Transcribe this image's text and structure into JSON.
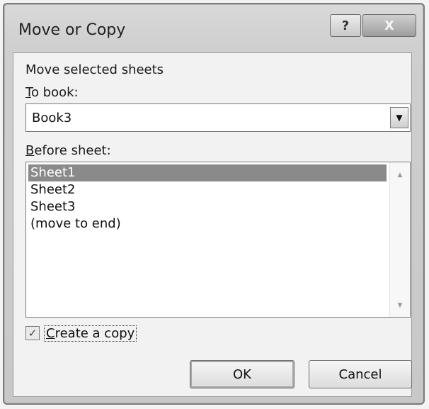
{
  "window": {
    "title": "Move or Copy",
    "help_glyph": "?",
    "close_glyph": "X"
  },
  "move_selected_label": "Move selected sheets",
  "to_book": {
    "label_mnemonic": "T",
    "label_rest": "o book:",
    "selected_value": "Book3",
    "dropdown_icon": "chevron-down-icon"
  },
  "before_sheet": {
    "label_mnemonic": "B",
    "label_rest": "efore sheet:",
    "items": [
      "Sheet1",
      "Sheet2",
      "Sheet3",
      "(move to end)"
    ],
    "selected_index": 0
  },
  "create_copy": {
    "checked": true,
    "label_mnemonic": "C",
    "label_rest": "reate a copy"
  },
  "buttons": {
    "ok_label": "OK",
    "cancel_label": "Cancel"
  }
}
